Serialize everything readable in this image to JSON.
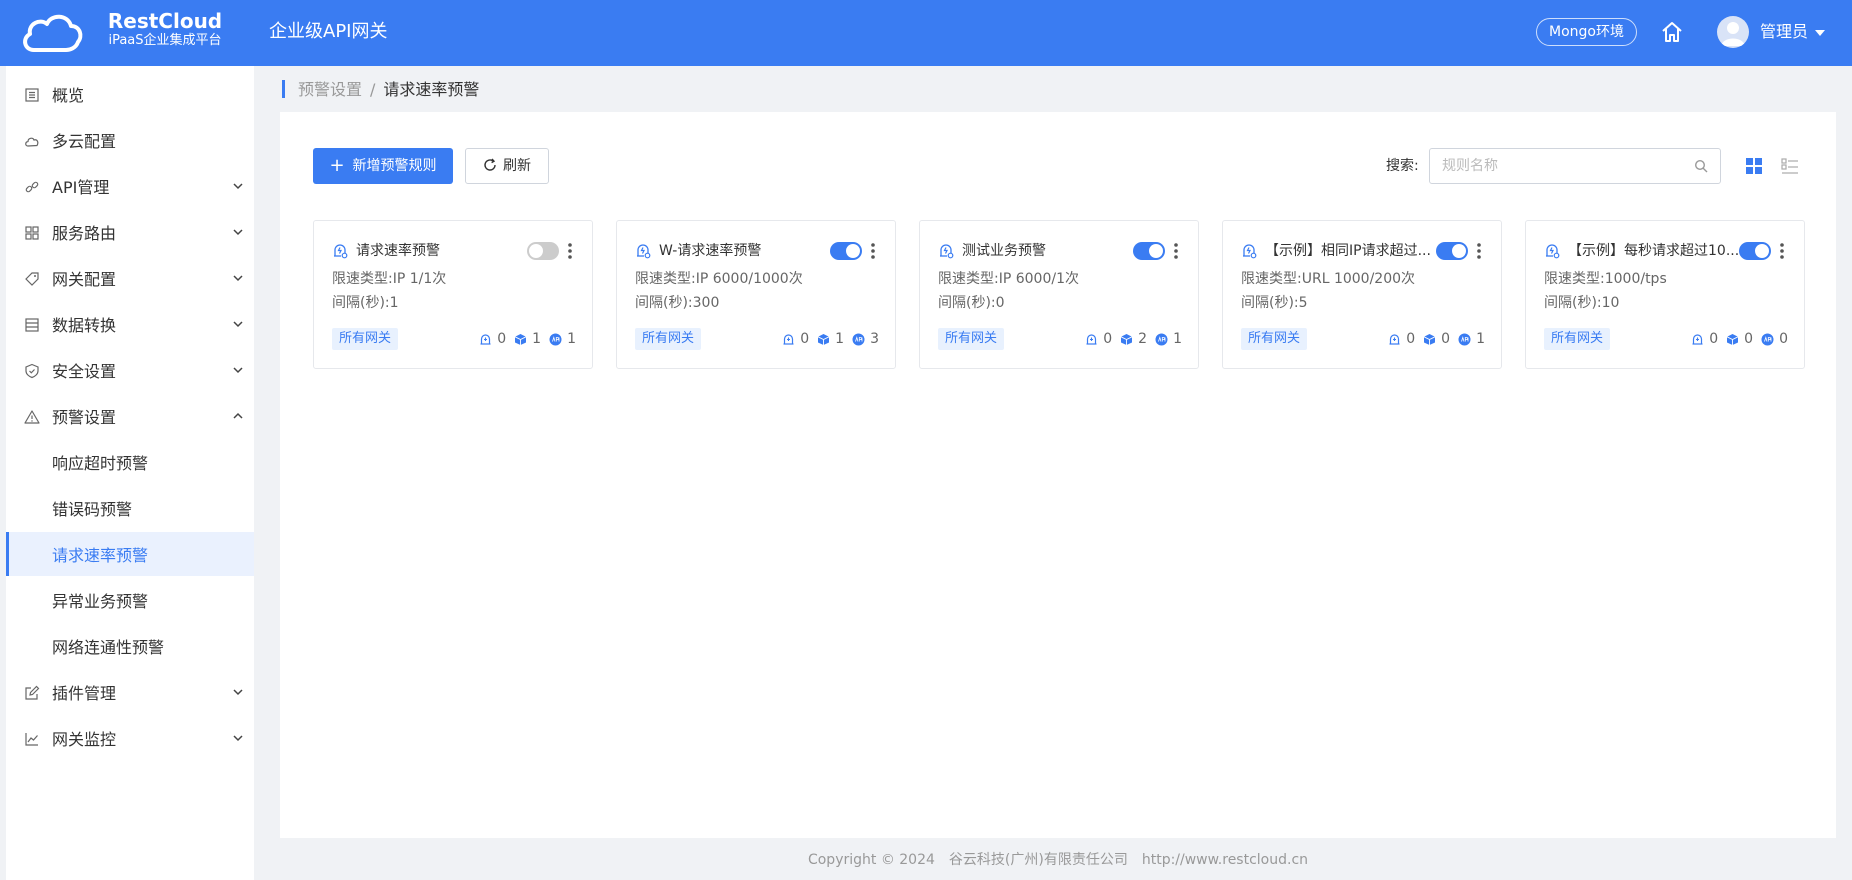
{
  "header": {
    "brand_name": "RestCloud",
    "brand_sub": "iPaaS企业集成平台",
    "title": "企业级API网关",
    "env": "Mongo环境",
    "user": "管理员"
  },
  "sidebar": {
    "items": [
      {
        "label": "概览",
        "icon": "list-icon"
      },
      {
        "label": "多云配置",
        "icon": "cloud-icon"
      },
      {
        "label": "API管理",
        "icon": "link-icon"
      },
      {
        "label": "服务路由",
        "icon": "grid-icon"
      },
      {
        "label": "网关配置",
        "icon": "tag-icon"
      },
      {
        "label": "数据转换",
        "icon": "table-icon"
      },
      {
        "label": "安全设置",
        "icon": "shield-icon"
      },
      {
        "label": "预警设置",
        "icon": "warning-icon"
      },
      {
        "label": "响应超时预警"
      },
      {
        "label": "错误码预警"
      },
      {
        "label": "请求速率预警"
      },
      {
        "label": "异常业务预警"
      },
      {
        "label": "网络连通性预警"
      },
      {
        "label": "插件管理",
        "icon": "edit-icon"
      },
      {
        "label": "网关监控",
        "icon": "chart-line-icon"
      }
    ]
  },
  "breadcrumb": {
    "parent": "预警设置",
    "sep": "/",
    "current": "请求速率预警"
  },
  "toolbar": {
    "add_label": "新增预警规则",
    "add_plus": "+",
    "refresh_label": "刷新",
    "search_label": "搜索:",
    "search_placeholder": "规则名称"
  },
  "cards": [
    {
      "title": "请求速率预警",
      "enabled": false,
      "type_label": "限速类型:",
      "type_value": "IP 1/1次",
      "interval_label": "间隔(秒):",
      "interval_value": "1",
      "tag": "所有网关",
      "stat1": "0",
      "stat2": "1",
      "stat3": "1"
    },
    {
      "title": "W-请求速率预警",
      "enabled": true,
      "type_label": "限速类型:",
      "type_value": "IP 6000/1000次",
      "interval_label": "间隔(秒):",
      "interval_value": "300",
      "tag": "所有网关",
      "stat1": "0",
      "stat2": "1",
      "stat3": "3"
    },
    {
      "title": "测试业务预警",
      "enabled": true,
      "type_label": "限速类型:",
      "type_value": "IP 6000/1次",
      "interval_label": "间隔(秒):",
      "interval_value": "0",
      "tag": "所有网关",
      "stat1": "0",
      "stat2": "2",
      "stat3": "1"
    },
    {
      "title": "【示例】相同IP请求超过...",
      "enabled": true,
      "type_label": "限速类型:",
      "type_value": "URL 1000/200次",
      "interval_label": "间隔(秒):",
      "interval_value": "5",
      "tag": "所有网关",
      "stat1": "0",
      "stat2": "0",
      "stat3": "1"
    },
    {
      "title": "【示例】每秒请求超过10...",
      "enabled": true,
      "type_label": "限速类型:",
      "type_value": "1000/tps",
      "interval_label": "间隔(秒):",
      "interval_value": "10",
      "tag": "所有网关",
      "stat1": "0",
      "stat2": "0",
      "stat3": "0"
    }
  ],
  "footer": {
    "copyright": "Copyright © 2024",
    "company": "谷云科技(广州)有限责任公司",
    "url": "http://www.restcloud.cn"
  },
  "colors": {
    "primary": "#3a7cf2",
    "header_bg": "#3a7cf2",
    "tag_bg": "#e8f1fe"
  }
}
